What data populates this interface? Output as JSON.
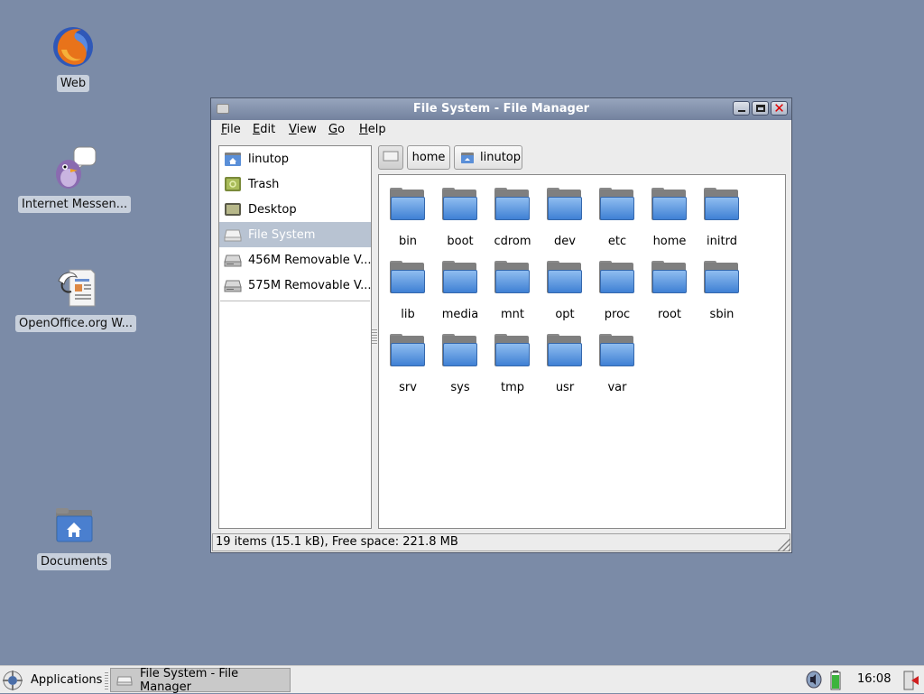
{
  "desktop": {
    "icons": [
      {
        "label": "Web",
        "icon": "firefox-icon"
      },
      {
        "label": "Internet Messen...",
        "icon": "pidgin-icon"
      },
      {
        "label": "OpenOffice.org W...",
        "icon": "openoffice-writer-icon"
      },
      {
        "label": "Documents",
        "icon": "home-folder-icon"
      }
    ]
  },
  "window": {
    "title": "File System - File Manager",
    "menu": [
      "File",
      "Edit",
      "View",
      "Go",
      "Help"
    ],
    "sidepane": {
      "items": [
        {
          "label": "linutop",
          "icon": "home-folder-icon",
          "selected": false
        },
        {
          "label": "Trash",
          "icon": "trash-icon",
          "selected": false
        },
        {
          "label": "Desktop",
          "icon": "desktop-icon",
          "selected": false
        },
        {
          "label": "File System",
          "icon": "drive-icon",
          "selected": true
        },
        {
          "label": "456M Removable V...",
          "icon": "removable-drive-icon",
          "selected": false
        },
        {
          "label": "575M Removable V...",
          "icon": "removable-drive-icon",
          "selected": false
        }
      ]
    },
    "pathbar": {
      "buttons": [
        "home",
        "linutop"
      ]
    },
    "folders": [
      "bin",
      "boot",
      "cdrom",
      "dev",
      "etc",
      "home",
      "initrd",
      "lib",
      "media",
      "mnt",
      "opt",
      "proc",
      "root",
      "sbin",
      "srv",
      "sys",
      "tmp",
      "usr",
      "var"
    ],
    "status": "19 items (15.1 kB), Free space: 221.8 MB"
  },
  "taskbar": {
    "applications_label": "Applications",
    "tasks": [
      {
        "label": "File System - File Manager"
      }
    ],
    "clock": "16:08"
  },
  "colors": {
    "desktop_bg": "#7b8ba7",
    "titlebar": "#8694af",
    "selection": "#b8c3d2",
    "folder_blue": "#5b9ae2"
  }
}
